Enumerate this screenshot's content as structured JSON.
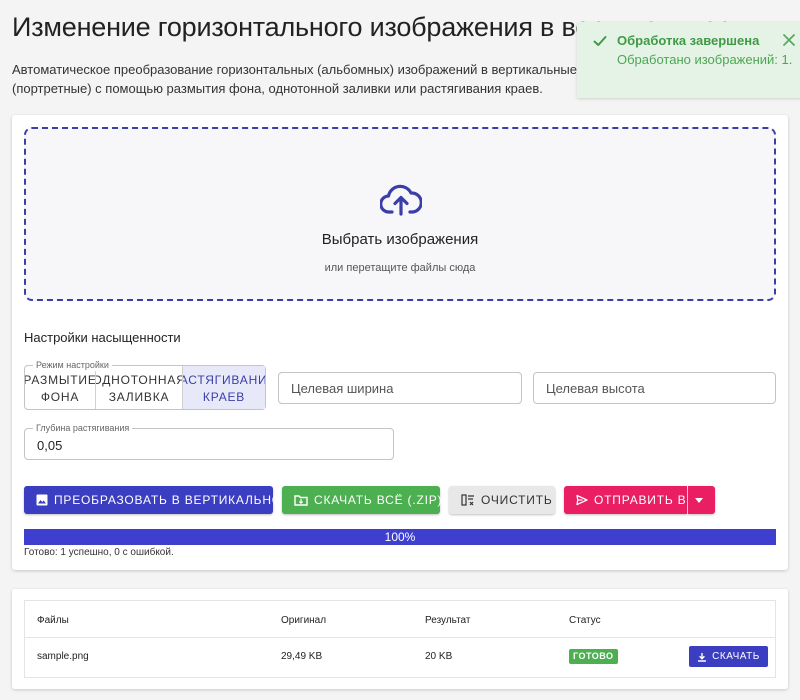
{
  "page": {
    "title": "Изменение горизонтального изображения в вертикальное",
    "description": "Автоматическое преобразование горизонтальных (альбомных) изображений в вертикальные (портретные) с помощью размытия фона, однотонной заливки или растягивания краев."
  },
  "toast": {
    "title": "Обработка завершена",
    "message": "Обработано изображений: 1.",
    "icon": "check-icon",
    "color": "#3f9a45"
  },
  "dropzone": {
    "title": "Выбрать изображения",
    "subtitle": "или перетащите файлы сюда",
    "icon": "cloud-upload-icon"
  },
  "settings": {
    "title": "Настройки насыщенности",
    "mode_label": "Режим настройки",
    "modes": [
      {
        "label": "Размытие фона",
        "active": false
      },
      {
        "label": "Однотонная заливка",
        "active": false
      },
      {
        "label": "Растягивание краев",
        "active": true
      }
    ],
    "width_placeholder": "Целевая ширина",
    "height_placeholder": "Целевая высота",
    "depth_label": "Глубина растягивания",
    "depth_value": "0,05"
  },
  "actions": {
    "convert": "Преобразовать в вертикальное",
    "zip": "Скачать всё (.ZIP)",
    "clear": "Очистить",
    "send": "Отправить в"
  },
  "progress": {
    "value": 100,
    "label": "100%",
    "status": "Готово: 1 успешно, 0 с ошибкой.",
    "color": "#3f3fcf"
  },
  "table": {
    "headers": [
      "Файлы",
      "Оригинал",
      "Результат",
      "Статус"
    ],
    "rows": [
      {
        "file": "sample.png",
        "original": "29,49 KB",
        "result": "20 KB",
        "status": "Готово",
        "action": "Скачать"
      }
    ]
  },
  "colors": {
    "primary": "#3b3ec0",
    "success": "#4caf50",
    "danger": "#e91e63"
  }
}
